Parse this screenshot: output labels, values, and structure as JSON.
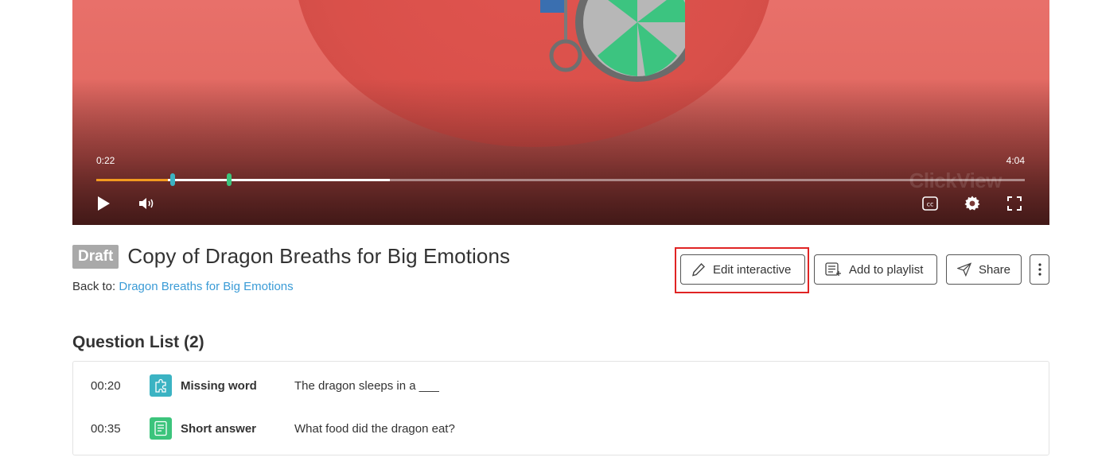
{
  "player": {
    "current_time": "0:22",
    "total_time": "4:04",
    "progress_played": 0.077,
    "progress_buffered": 0.316,
    "markers": [
      {
        "time": "00:20",
        "color": "#3bb3c3"
      },
      {
        "time": "00:35",
        "color": "#3cc47c"
      }
    ],
    "watermark": "ClickView",
    "colors": {
      "played": "#f39a1f",
      "accent_red": "#e0544f"
    }
  },
  "title": {
    "badge": "Draft",
    "text": "Copy of Dragon Breaths for Big Emotions",
    "back_label": "Back to:",
    "back_link": "Dragon Breaths for Big Emotions"
  },
  "actions": {
    "edit_interactive": "Edit interactive",
    "add_to_playlist": "Add to playlist",
    "share": "Share"
  },
  "questions": {
    "heading": "Question List (2)",
    "items": [
      {
        "time": "00:20",
        "type": "Missing word",
        "text": "The dragon sleeps in a ___",
        "icon": "puzzle-icon",
        "color": "#3bb3c3"
      },
      {
        "time": "00:35",
        "type": "Short answer",
        "text": "What food did the dragon eat?",
        "icon": "document-icon",
        "color": "#3cc47c"
      }
    ]
  }
}
